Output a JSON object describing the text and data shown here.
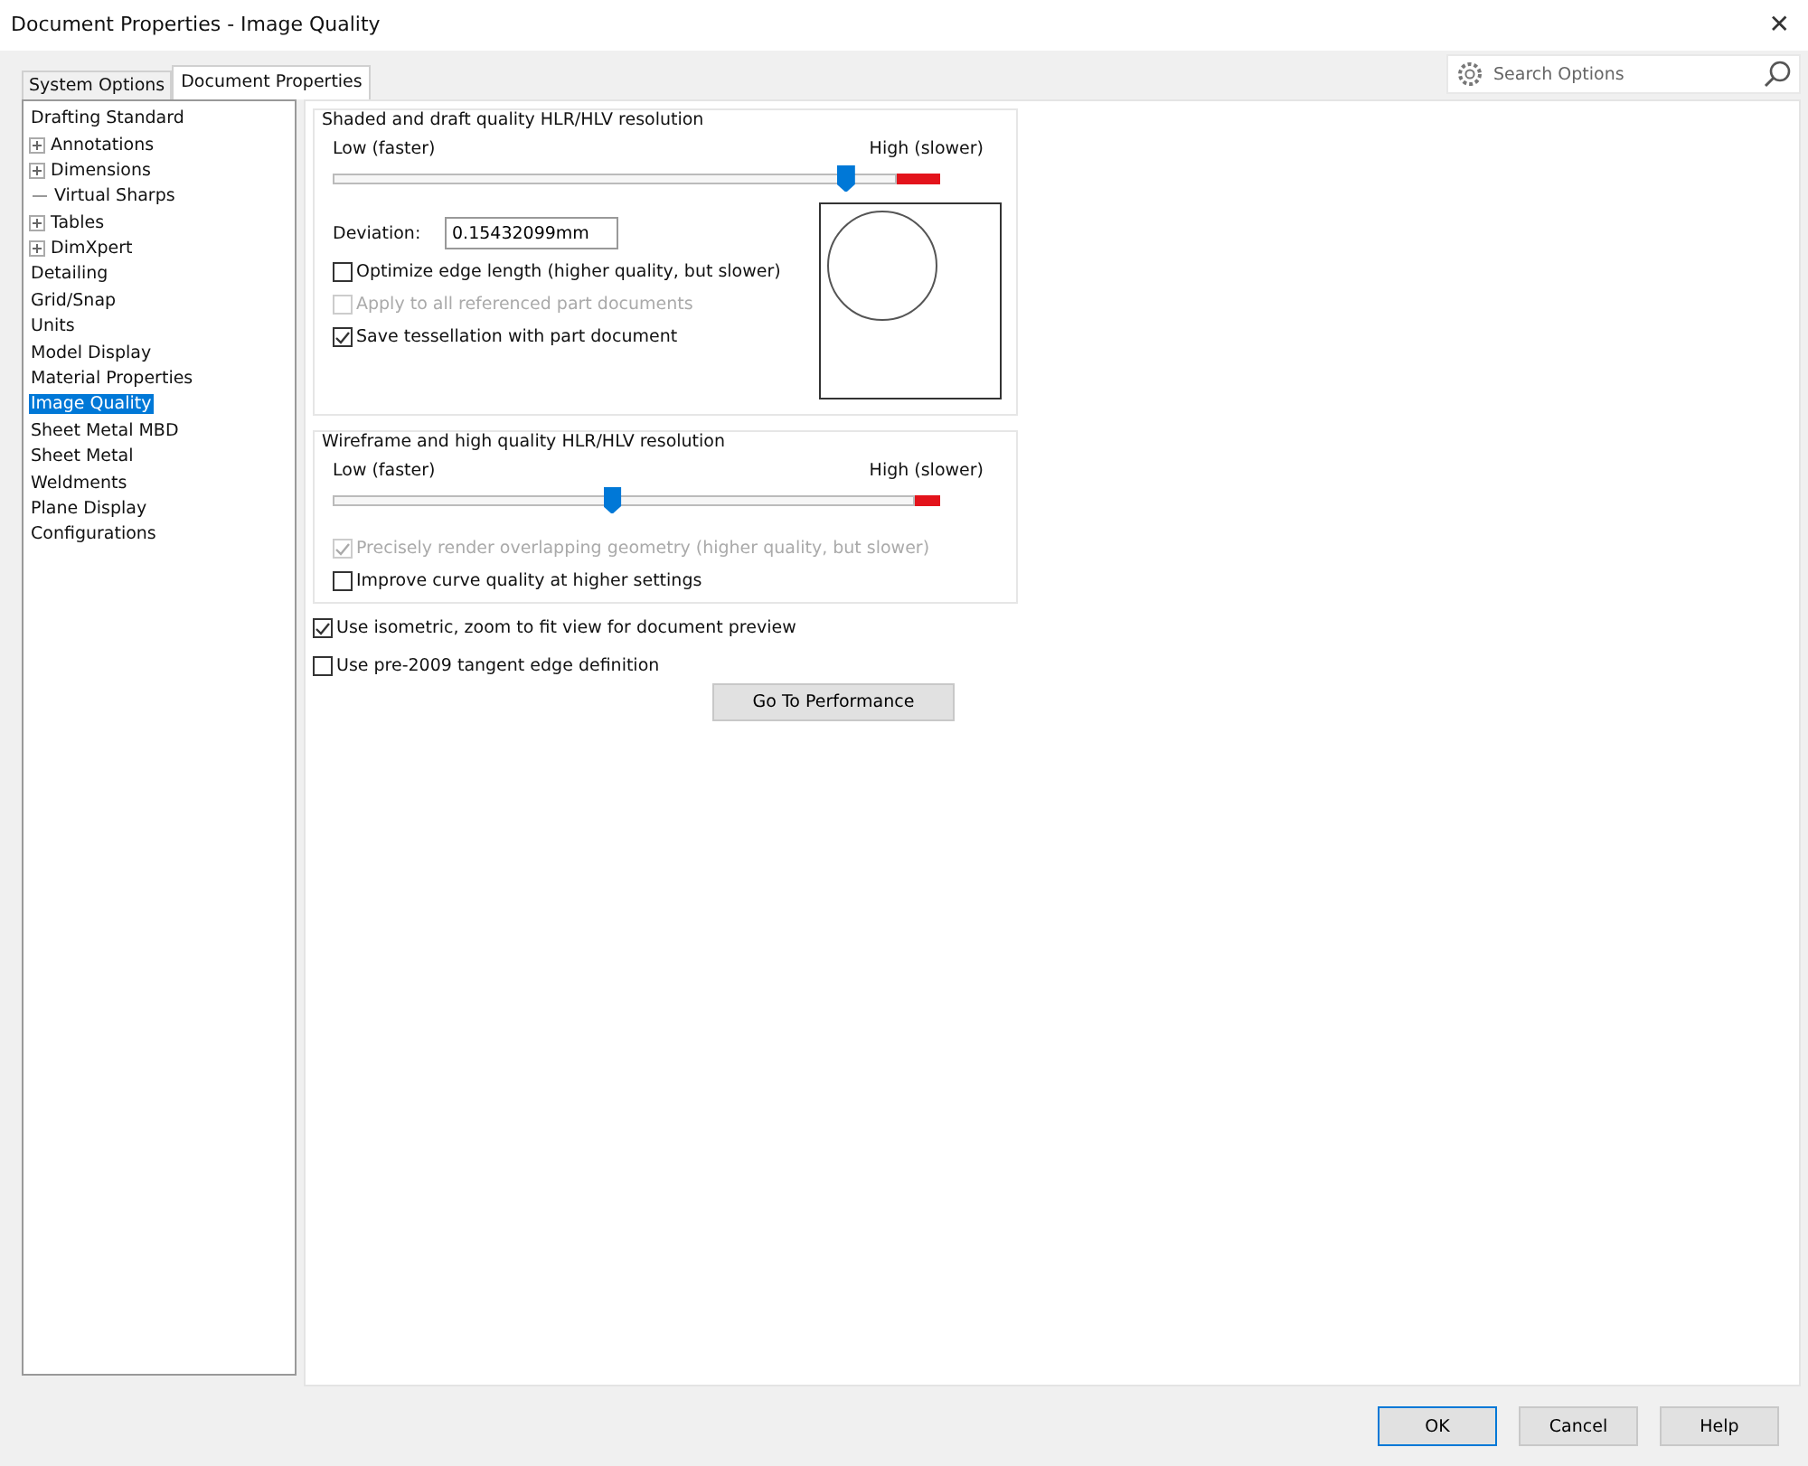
{
  "window": {
    "title": "Document Properties - Image Quality",
    "close": "✕"
  },
  "tabs": [
    {
      "label": "System Options",
      "selected": false
    },
    {
      "label": "Document Properties",
      "selected": true
    }
  ],
  "search": {
    "placeholder": "Search Options"
  },
  "tree": [
    {
      "label": "Drafting Standard",
      "kind": "plain",
      "selected": false
    },
    {
      "label": "Annotations",
      "kind": "expandable",
      "expanded": false,
      "selected": false
    },
    {
      "label": "Dimensions",
      "kind": "expandable",
      "expanded": false,
      "selected": false
    },
    {
      "label": "Virtual Sharps",
      "kind": "connector",
      "selected": false
    },
    {
      "label": "Tables",
      "kind": "expandable",
      "expanded": false,
      "selected": false
    },
    {
      "label": "DimXpert",
      "kind": "expandable",
      "expanded": false,
      "selected": false
    },
    {
      "label": "Detailing",
      "kind": "plain",
      "selected": false
    },
    {
      "label": "Grid/Snap",
      "kind": "plain",
      "selected": false
    },
    {
      "label": "Units",
      "kind": "plain",
      "selected": false
    },
    {
      "label": "Model Display",
      "kind": "plain",
      "selected": false
    },
    {
      "label": "Material Properties",
      "kind": "plain",
      "selected": false
    },
    {
      "label": "Image Quality",
      "kind": "plain",
      "selected": true
    },
    {
      "label": "Sheet Metal MBD",
      "kind": "plain",
      "selected": false
    },
    {
      "label": "Sheet Metal",
      "kind": "plain",
      "selected": false
    },
    {
      "label": "Weldments",
      "kind": "plain",
      "selected": false
    },
    {
      "label": "Plane Display",
      "kind": "plain",
      "selected": false
    },
    {
      "label": "Configurations",
      "kind": "plain",
      "selected": false
    }
  ],
  "shaded_group": {
    "title": "Shaded and draft quality HLR/HLV resolution",
    "low_label": "Low (faster)",
    "high_label": "High (slower)",
    "level": 0.91,
    "deviation": {
      "label": "Deviation:",
      "value": "0.15432099mm"
    },
    "checkboxes": [
      {
        "label": "Optimize edge length (higher quality, but slower)",
        "checked": false,
        "disabled": false
      },
      {
        "label": "Apply to all referenced part documents",
        "checked": false,
        "disabled": true
      },
      {
        "label": "Save tessellation with part document",
        "checked": true,
        "disabled": false
      }
    ]
  },
  "wireframe_group": {
    "title": "Wireframe and high quality HLR/HLV resolution",
    "low_label": "Low (faster)",
    "high_label": "High (slower)",
    "level": 0.48,
    "checkboxes": [
      {
        "label": "Precisely render overlapping geometry (higher quality, but slower)",
        "checked": true,
        "disabled": true
      },
      {
        "label": "Improve curve quality at higher settings",
        "checked": false,
        "disabled": false
      }
    ]
  },
  "options": [
    {
      "label": "Use isometric, zoom to fit view for document preview",
      "checked": true,
      "disabled": false
    },
    {
      "label": "Use pre-2009 tangent edge definition",
      "checked": false,
      "disabled": false
    }
  ],
  "performance_button": "Go To Performance",
  "buttons": [
    {
      "label": "OK",
      "default": true
    },
    {
      "label": "Cancel",
      "default": false
    },
    {
      "label": "Help",
      "default": false
    }
  ]
}
